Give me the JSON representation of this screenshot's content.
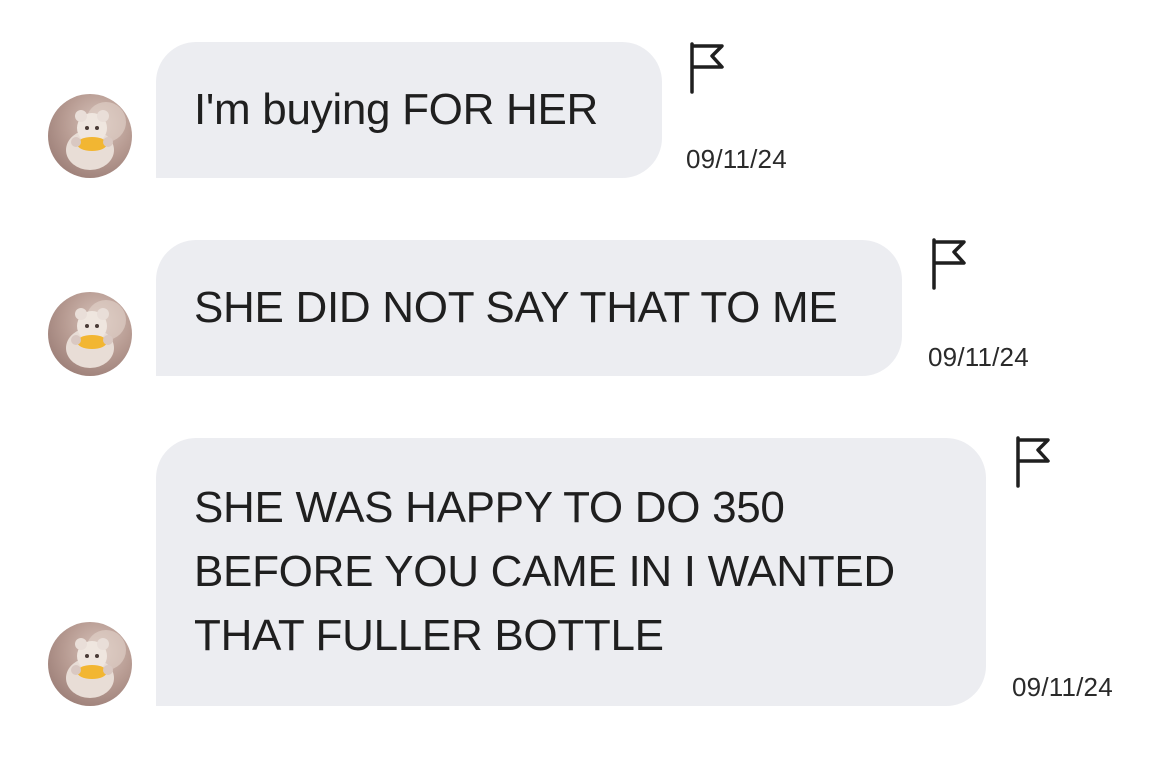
{
  "messages": [
    {
      "text": "I'm buying FOR HER",
      "timestamp": "09/11/24",
      "flag_icon": "flag-icon",
      "avatar_icon": "bear-avatar"
    },
    {
      "text": "SHE DID NOT SAY THAT TO ME",
      "timestamp": "09/11/24",
      "flag_icon": "flag-icon",
      "avatar_icon": "bear-avatar"
    },
    {
      "text": "SHE WAS HAPPY TO DO 350\nBEFORE YOU CAME IN I WANTED\nTHAT FULLER BOTTLE",
      "timestamp": "09/11/24",
      "flag_icon": "flag-icon",
      "avatar_icon": "bear-avatar"
    }
  ],
  "colors": {
    "bubble": "#ecedf1",
    "text": "#1f1f1f",
    "background": "#ffffff"
  }
}
